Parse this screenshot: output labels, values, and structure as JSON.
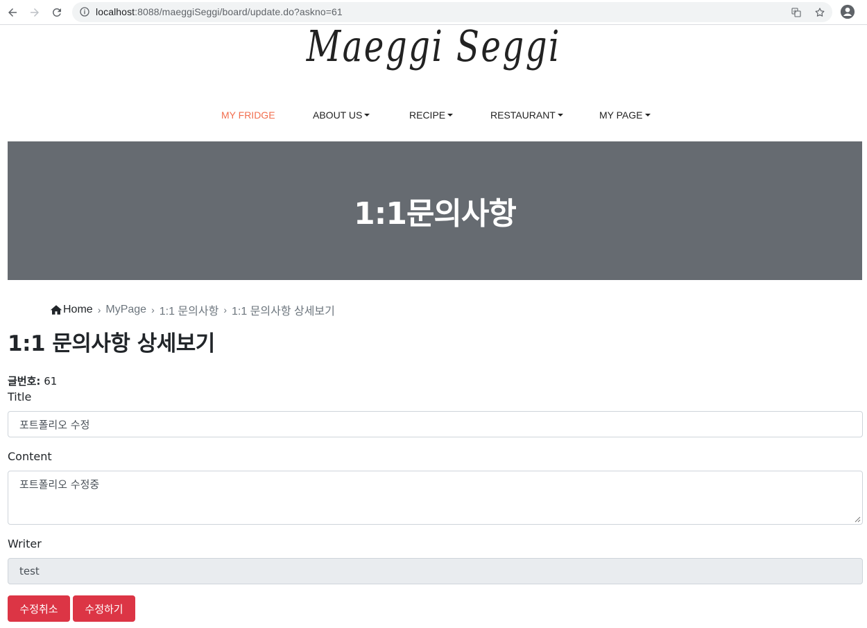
{
  "browser": {
    "url_host": "localhost",
    "url_rest": ":8088/maeggiSeggi/board/update.do?askno=61"
  },
  "site": {
    "logo": "Maeggi Seggi"
  },
  "nav": {
    "items": [
      {
        "label": "MY FRIDGE",
        "dropdown": false,
        "active": true
      },
      {
        "label": "ABOUT US",
        "dropdown": true,
        "active": false
      },
      {
        "label": "RECIPE",
        "dropdown": true,
        "active": false
      },
      {
        "label": "RESTAURANT",
        "dropdown": true,
        "active": false
      },
      {
        "label": "MY PAGE",
        "dropdown": true,
        "active": false
      }
    ],
    "active_color": "#f26d4d"
  },
  "hero": {
    "title": "1:1문의사항",
    "background": "#666b71"
  },
  "breadcrumb": {
    "home": "Home",
    "items": [
      "MyPage",
      "1:1 문의사항",
      "1:1 문의사항 상세보기"
    ]
  },
  "page": {
    "heading": "1:1 문의사항 상세보기",
    "post_no_label": "글번호:",
    "post_no_value": "61"
  },
  "form": {
    "title_label": "Title",
    "title_value": "포트폴리오 수정",
    "content_label": "Content",
    "content_value": "포트폴리오 수정중",
    "writer_label": "Writer",
    "writer_value": "test"
  },
  "buttons": {
    "cancel": "수정취소",
    "submit": "수정하기",
    "color": "#dc3545"
  }
}
